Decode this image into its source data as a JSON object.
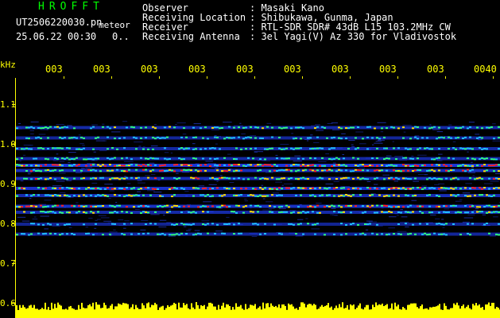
{
  "header": {
    "app_title": "HROFFT",
    "file_name": "UT2506220030.pn",
    "mode": "meteor",
    "date_time": "25.06.22 00:30",
    "indicator": "0..",
    "meta": [
      {
        "key": "Observer",
        "value": ": Masaki Kano"
      },
      {
        "key": "Receiving Location",
        "value": ": Shibukawa, Gunma, Japan"
      },
      {
        "key": "Receiver",
        "value": ": RTL-SDR SDR# 43dB L15 103.2MHz CW"
      },
      {
        "key": "Receiving Antenna",
        "value": ": 3el Yagi(V) Az 330 for Vladivostok"
      }
    ]
  },
  "axes": {
    "y_unit": "kHz",
    "y_labels": [
      "1.1",
      "1.0",
      "0.9",
      "0.8",
      "0.7",
      "0.6"
    ],
    "time_labels": [
      "003",
      "003",
      "003",
      "003",
      "003",
      "003",
      "003",
      "003",
      "003",
      "0040"
    ]
  },
  "colors": {
    "header_green": "#00ff00",
    "text_white": "#ffffff",
    "axis_yellow": "#ffff00",
    "background": "#000000",
    "spectro_low": "#000033",
    "spectro_mid": "#2040ff",
    "spectro_high": "#ff2020"
  },
  "spectrogram": {
    "freq_range_khz": [
      0.6,
      1.15
    ],
    "bands": [
      {
        "freq_khz": 1.043,
        "level": 0.55
      },
      {
        "freq_khz": 1.017,
        "level": 0.45
      },
      {
        "freq_khz": 0.99,
        "level": 0.5
      },
      {
        "freq_khz": 0.965,
        "level": 0.5
      },
      {
        "freq_khz": 0.948,
        "level": 0.9
      },
      {
        "freq_khz": 0.935,
        "level": 0.7
      },
      {
        "freq_khz": 0.915,
        "level": 0.65
      },
      {
        "freq_khz": 0.89,
        "level": 0.8
      },
      {
        "freq_khz": 0.872,
        "level": 0.6
      },
      {
        "freq_khz": 0.845,
        "level": 0.75
      },
      {
        "freq_khz": 0.83,
        "level": 0.55
      },
      {
        "freq_khz": 0.8,
        "level": 0.4
      },
      {
        "freq_khz": 0.775,
        "level": 0.45
      }
    ]
  }
}
